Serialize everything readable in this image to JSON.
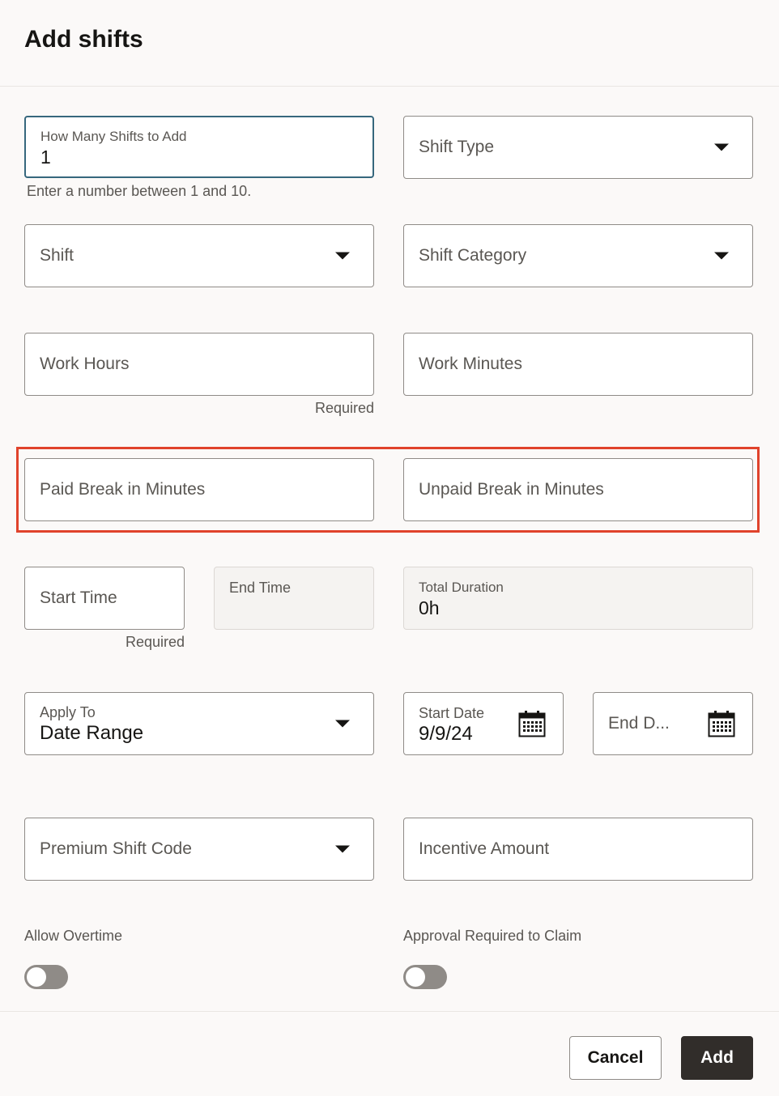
{
  "header": {
    "title": "Add shifts"
  },
  "fields": {
    "shifts_count": {
      "label": "How Many Shifts to Add",
      "value": "1",
      "helper": "Enter a number between 1 and 10."
    },
    "shift_type": {
      "placeholder": "Shift Type"
    },
    "shift": {
      "placeholder": "Shift"
    },
    "shift_category": {
      "placeholder": "Shift Category"
    },
    "work_hours": {
      "placeholder": "Work Hours",
      "helper": "Required"
    },
    "work_minutes": {
      "placeholder": "Work Minutes"
    },
    "paid_break": {
      "placeholder": "Paid Break in Minutes"
    },
    "unpaid_break": {
      "placeholder": "Unpaid Break in Minutes"
    },
    "start_time": {
      "placeholder": "Start Time",
      "helper": "Required"
    },
    "end_time": {
      "label": "End Time"
    },
    "total_duration": {
      "label": "Total Duration",
      "value": "0h"
    },
    "apply_to": {
      "label": "Apply To",
      "value": "Date Range"
    },
    "start_date": {
      "label": "Start Date",
      "value": "9/9/24"
    },
    "end_date": {
      "placeholder": "End D..."
    },
    "premium_shift_code": {
      "placeholder": "Premium Shift Code"
    },
    "incentive_amount": {
      "placeholder": "Incentive Amount"
    }
  },
  "toggles": {
    "allow_overtime": {
      "label": "Allow Overtime",
      "on": false
    },
    "approval_required": {
      "label": "Approval Required to Claim",
      "on": false
    }
  },
  "footer": {
    "cancel_label": "Cancel",
    "add_label": "Add"
  },
  "icons": {
    "dropdown": "chevron-down-icon",
    "calendar": "calendar-icon"
  },
  "colors": {
    "highlight": "#e0432c",
    "focus_border": "#36677d",
    "primary_button": "#312d2a"
  }
}
